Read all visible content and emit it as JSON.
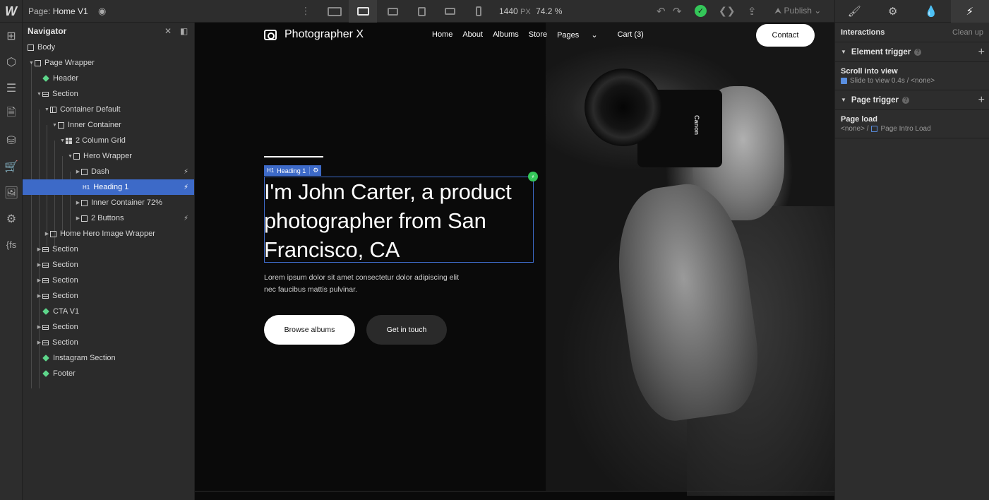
{
  "topbar": {
    "page_prefix": "Page:",
    "page_name": "Home V1",
    "width_value": "1440",
    "width_unit": "PX",
    "zoom": "74.2 %",
    "publish_label": "Publish"
  },
  "navigator": {
    "title": "Navigator",
    "rows": [
      {
        "label": "Body"
      },
      {
        "label": "Page Wrapper"
      },
      {
        "label": "Header"
      },
      {
        "label": "Section"
      },
      {
        "label": "Container Default"
      },
      {
        "label": "Inner Container"
      },
      {
        "label": "2 Column Grid"
      },
      {
        "label": "Hero Wrapper"
      },
      {
        "label": "Dash"
      },
      {
        "label": "Heading 1"
      },
      {
        "label": "Inner Container 72%"
      },
      {
        "label": "2 Buttons"
      },
      {
        "label": "Home Hero Image Wrapper"
      },
      {
        "label": "Section"
      },
      {
        "label": "Section"
      },
      {
        "label": "Section"
      },
      {
        "label": "Section"
      },
      {
        "label": "CTA V1"
      },
      {
        "label": "Section"
      },
      {
        "label": "Section"
      },
      {
        "label": "Instagram Section"
      },
      {
        "label": "Footer"
      }
    ],
    "h1_badge": "H1"
  },
  "site": {
    "brand": "Photographer X",
    "nav": [
      "Home",
      "About",
      "Albums",
      "Store",
      "Pages",
      "Cart (3)"
    ],
    "contact": "Contact",
    "selection_tag": "Heading 1",
    "heading": "I'm John Carter, a product photographer from San Francisco, CA",
    "paragraph": "Lorem ipsum dolor sit amet consectetur dolor adipiscing elit nec faucibus mattis pulvinar.",
    "browse_button": "Browse albums",
    "touch_button": "Get in touch",
    "camera_brand": "Canon"
  },
  "interactions": {
    "title": "Interactions",
    "cleanup": "Clean up",
    "element_trigger": "Element trigger",
    "element_item_title": "Scroll into view",
    "element_item_detail": "Slide to view 0.4s / <none>",
    "page_trigger": "Page trigger",
    "page_item_title": "Page load",
    "page_item_detail_a": "<none> /",
    "page_item_detail_b": "Page Intro Load"
  },
  "colors": {
    "accent": "#3d6ac8",
    "success": "#34c759",
    "symbol": "#5dd68a"
  }
}
